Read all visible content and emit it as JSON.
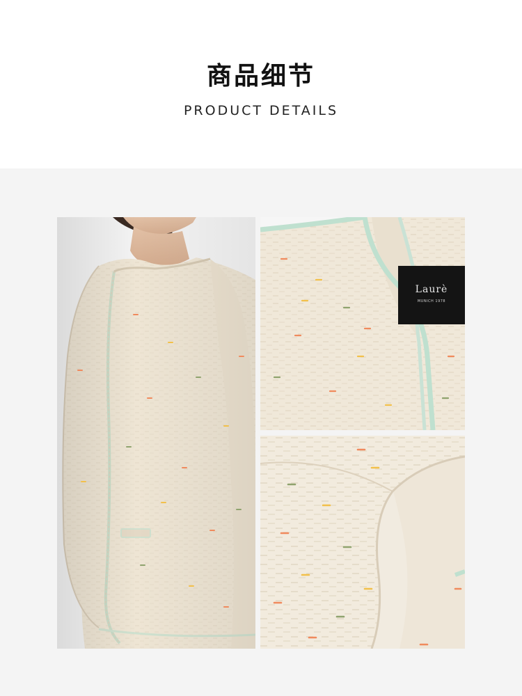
{
  "header": {
    "title_cn": "商品细节",
    "title_en": "PRODUCT DETAILS"
  },
  "gallery": {
    "label_brand": "Laurè",
    "label_sub": "MUNICH 1978"
  },
  "colors": {
    "background": "#ffffff",
    "gallery_background": "#f4f4f4",
    "fabric": "#efe6d6",
    "fabric_shadow": "#ddd2bf",
    "fleck_orange": "#f08a5d",
    "fleck_yellow": "#f2c04a",
    "fleck_green": "#8fa36e",
    "trim_mint": "#b9dccb",
    "label_black": "#141414"
  }
}
